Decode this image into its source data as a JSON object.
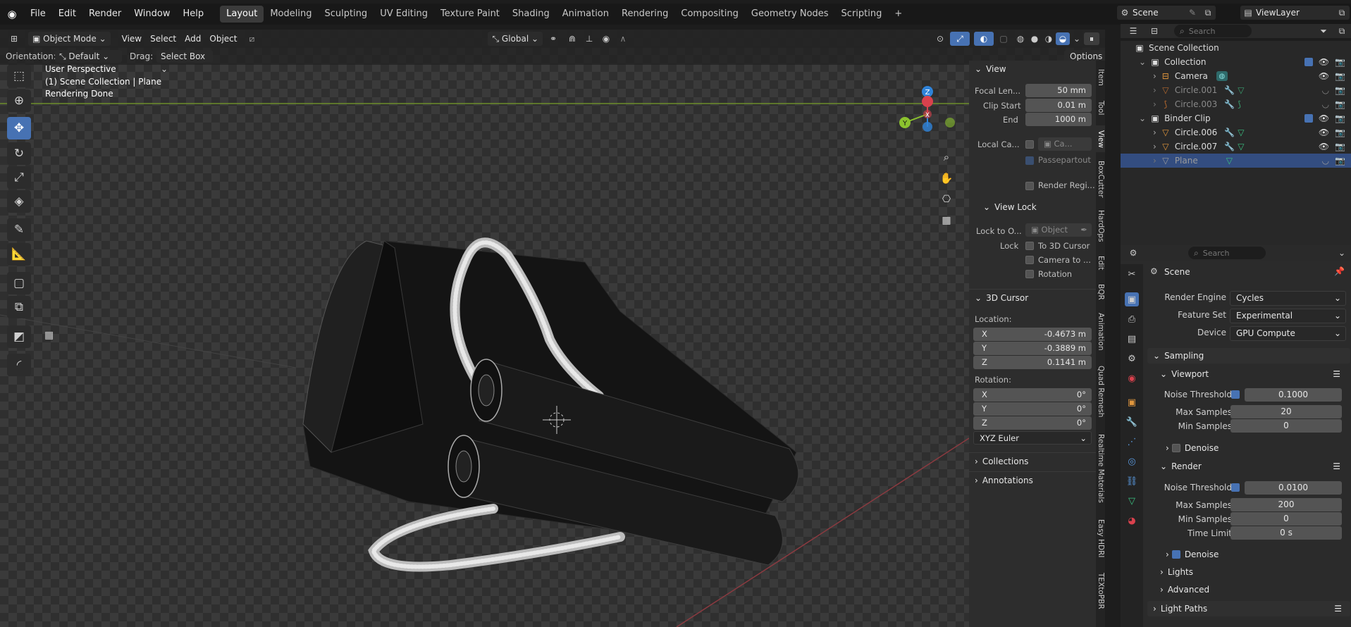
{
  "topbar": {
    "menus": [
      "File",
      "Edit",
      "Render",
      "Window",
      "Help"
    ],
    "workspaces": [
      "Layout",
      "Modeling",
      "Sculpting",
      "UV Editing",
      "Texture Paint",
      "Shading",
      "Animation",
      "Rendering",
      "Compositing",
      "Geometry Nodes",
      "Scripting"
    ],
    "active_workspace": "Layout",
    "add_tab": "+",
    "scene_name": "Scene",
    "view_layer": "ViewLayer"
  },
  "viewport_header": {
    "mode": "Object Mode",
    "menus": [
      "View",
      "Select",
      "Add",
      "Object"
    ],
    "transform_orientation": "Global",
    "orientation_label": "Orientation:",
    "orientation_value": "Default",
    "drag_label": "Drag:",
    "drag_value": "Select Box",
    "options": "Options"
  },
  "overlay_text": {
    "line1": "User Perspective",
    "line2": "(1) Scene Collection | Plane",
    "line3": "Rendering Done"
  },
  "gizmo": {
    "z": "Z",
    "y": "Y",
    "x": "X"
  },
  "npanel": {
    "view_header": "View",
    "focal_length_label": "Focal Len...",
    "focal_length": "50 mm",
    "clip_start_label": "Clip Start",
    "clip_start": "0.01 m",
    "end_label": "End",
    "end": "1000 m",
    "local_camera_label": "Local Ca...",
    "local_camera_value": "Ca...",
    "passepartout": "Passepartout",
    "render_region": "Render Regi...",
    "view_lock_header": "View Lock",
    "lock_to_object_label": "Lock to O...",
    "lock_to_object_value": "Object",
    "lock_label": "Lock",
    "to_3d_cursor": "To 3D Cursor",
    "camera_to": "Camera to ...",
    "rotation_lock": "Rotation",
    "cursor_header": "3D Cursor",
    "location_label": "Location:",
    "loc_x_label": "X",
    "loc_x": "-0.4673 m",
    "loc_y_label": "Y",
    "loc_y": "-0.3889 m",
    "loc_z_label": "Z",
    "loc_z": "0.1141 m",
    "rotation_label": "Rotation:",
    "rot_x_label": "X",
    "rot_x": "0°",
    "rot_y_label": "Y",
    "rot_y": "0°",
    "rot_z_label": "Z",
    "rot_z": "0°",
    "rotation_mode": "XYZ Euler",
    "collections": "Collections",
    "annotations": "Annotations"
  },
  "side_tabs": [
    "Item",
    "Tool",
    "View",
    "BoxCutter",
    "HardOps",
    "Edit",
    "BQR",
    "Animation",
    "Quad Remesh",
    "Realtime Materials",
    "Easy HDRI",
    "TEXtoPBR"
  ],
  "outliner": {
    "search_placeholder": "Search",
    "rows": [
      {
        "name": "Scene Collection"
      },
      {
        "name": "Collection"
      },
      {
        "name": "Camera"
      },
      {
        "name": "Circle.001"
      },
      {
        "name": "Circle.003"
      },
      {
        "name": "Binder Clip"
      },
      {
        "name": "Circle.006"
      },
      {
        "name": "Circle.007"
      },
      {
        "name": "Plane"
      }
    ]
  },
  "properties": {
    "search_placeholder": "Search",
    "scene_title": "Scene",
    "render_engine_label": "Render Engine",
    "render_engine": "Cycles",
    "feature_set_label": "Feature Set",
    "feature_set": "Experimental",
    "device_label": "Device",
    "device": "GPU Compute",
    "sampling": "Sampling",
    "viewport": "Viewport",
    "vp_noise_label": "Noise Threshold",
    "vp_noise": "0.1000",
    "vp_max_label": "Max Samples",
    "vp_max": "20",
    "vp_min_label": "Min Samples",
    "vp_min": "0",
    "vp_denoise": "Denoise",
    "render": "Render",
    "r_noise_label": "Noise Threshold",
    "r_noise": "0.0100",
    "r_max_label": "Max Samples",
    "r_max": "200",
    "r_min_label": "Min Samples",
    "r_min": "0",
    "time_limit_label": "Time Limit",
    "time_limit": "0 s",
    "r_denoise": "Denoise",
    "lights": "Lights",
    "advanced": "Advanced",
    "light_paths": "Light Paths"
  },
  "colors": {
    "accent": "#4772b3",
    "selected_row": "#334d80",
    "x_axis": "#d9414d",
    "y_axis": "#8bc22e",
    "z_axis": "#2f83d9"
  }
}
